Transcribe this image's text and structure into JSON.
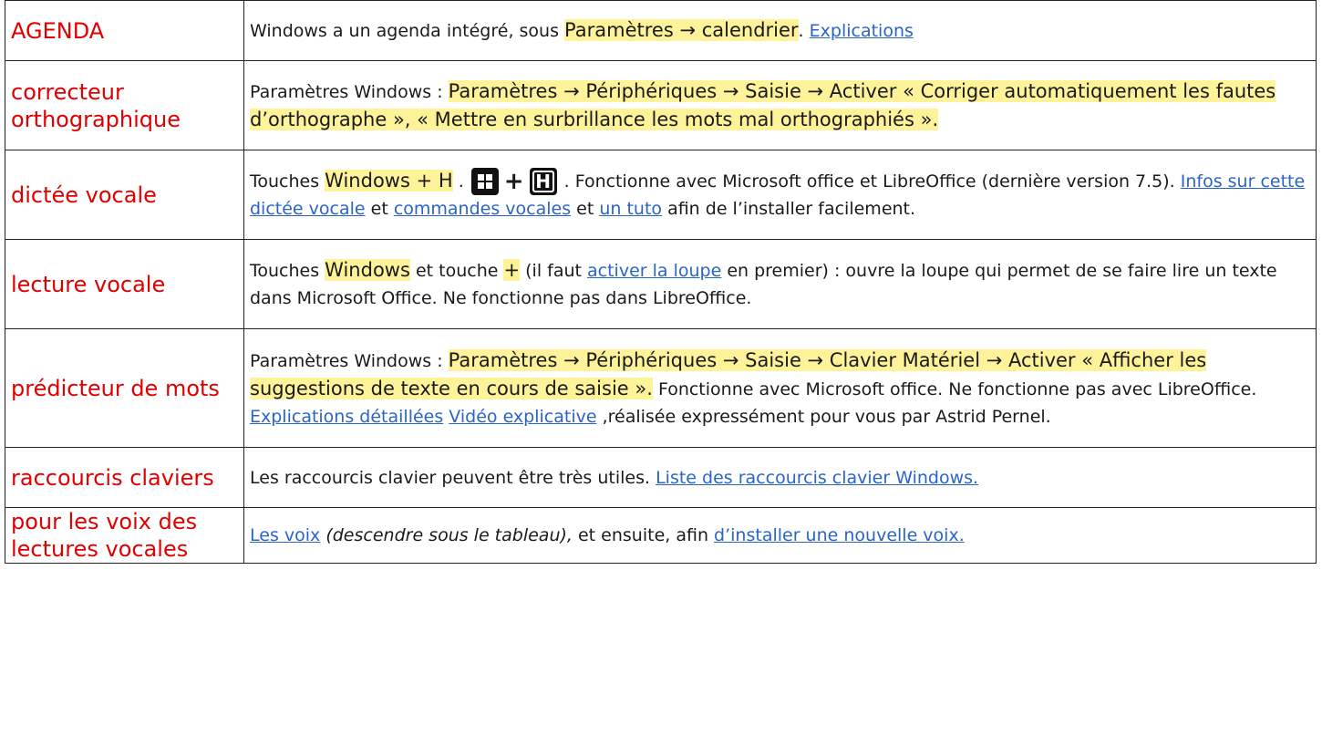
{
  "rows": [
    {
      "label": "AGENDA",
      "segments": [
        {
          "t": "Windows a un agenda intégré, sous "
        },
        {
          "t": "Paramètres → calendrier",
          "hl": true
        },
        {
          "t": ". "
        },
        {
          "t": "Explications",
          "link": true
        }
      ]
    },
    {
      "label": "correcteur orthographique",
      "segments": [
        {
          "t": "Paramètres Windows : "
        },
        {
          "t": "Paramètres → Périphériques → Saisie → Activer « Corriger automatiquement les fautes d’orthographe », « Mettre en surbrillance les mots mal orthographiés ».",
          "hl": true
        }
      ]
    },
    {
      "label": "dictée vocale",
      "segments": [
        {
          "t": "Touches "
        },
        {
          "t": "Windows + H",
          "hl": true
        },
        {
          "t": " . "
        },
        {
          "key": "windows-key-icon"
        },
        {
          "plus": "+"
        },
        {
          "key": "h-key-icon",
          "glyph": "H"
        },
        {
          "t": " .  Fonctionne avec Microsoft office et LibreOffice (dernière version 7.5). "
        },
        {
          "t": "Infos sur cette dictée vocale",
          "link": true
        },
        {
          "t": " et "
        },
        {
          "t": "commandes vocales",
          "link": true
        },
        {
          "t": " et "
        },
        {
          "t": "un tuto",
          "link": true
        },
        {
          "t": " afin de l’installer facilement."
        }
      ]
    },
    {
      "label": "lecture vocale",
      "segments": [
        {
          "t": "Touches "
        },
        {
          "t": "Windows",
          "hl": true
        },
        {
          "t": " et touche "
        },
        {
          "t": "+",
          "hl": true
        },
        {
          "t": " (il faut "
        },
        {
          "t": "activer la loupe",
          "link": true
        },
        {
          "t": " en premier) : ouvre la loupe qui permet de se faire lire un texte dans Microsoft Office. Ne fonctionne pas dans LibreOffice."
        }
      ]
    },
    {
      "label": "prédicteur de mots",
      "segments": [
        {
          "t": "Paramètres Windows : "
        },
        {
          "t": "Paramètres → Périphériques → Saisie → Clavier Matériel → Activer « Afficher les suggestions de texte en cours de saisie ».",
          "hl": true
        },
        {
          "t": " Fonctionne avec Microsoft office. Ne fonctionne pas avec LibreOffice. "
        },
        {
          "t": "Explications détaillées",
          "link": true
        },
        {
          "t": "   "
        },
        {
          "t": "Vidéo explicative",
          "link": true
        },
        {
          "t": " ,réalisée expressément pour vous par Astrid Pernel."
        }
      ]
    },
    {
      "label": "raccourcis claviers",
      "segments": [
        {
          "t": "Les raccourcis clavier peuvent être très utiles. "
        },
        {
          "t": "Liste des raccourcis clavier Windows.",
          "link": true
        }
      ]
    },
    {
      "label": "pour les voix des lectures vocales",
      "segments": [
        {
          "t": "Les voix",
          "link": true
        },
        {
          "t": " "
        },
        {
          "t": "(descendre sous le tableau),",
          "ital": true
        },
        {
          "t": " et ensuite, afin "
        },
        {
          "t": "d’installer une nouvelle voix.",
          "link": true
        }
      ]
    }
  ],
  "colors": {
    "label": "#e00000",
    "highlight": "#fff39a",
    "link": "#2a64c6",
    "border": "#222222"
  }
}
